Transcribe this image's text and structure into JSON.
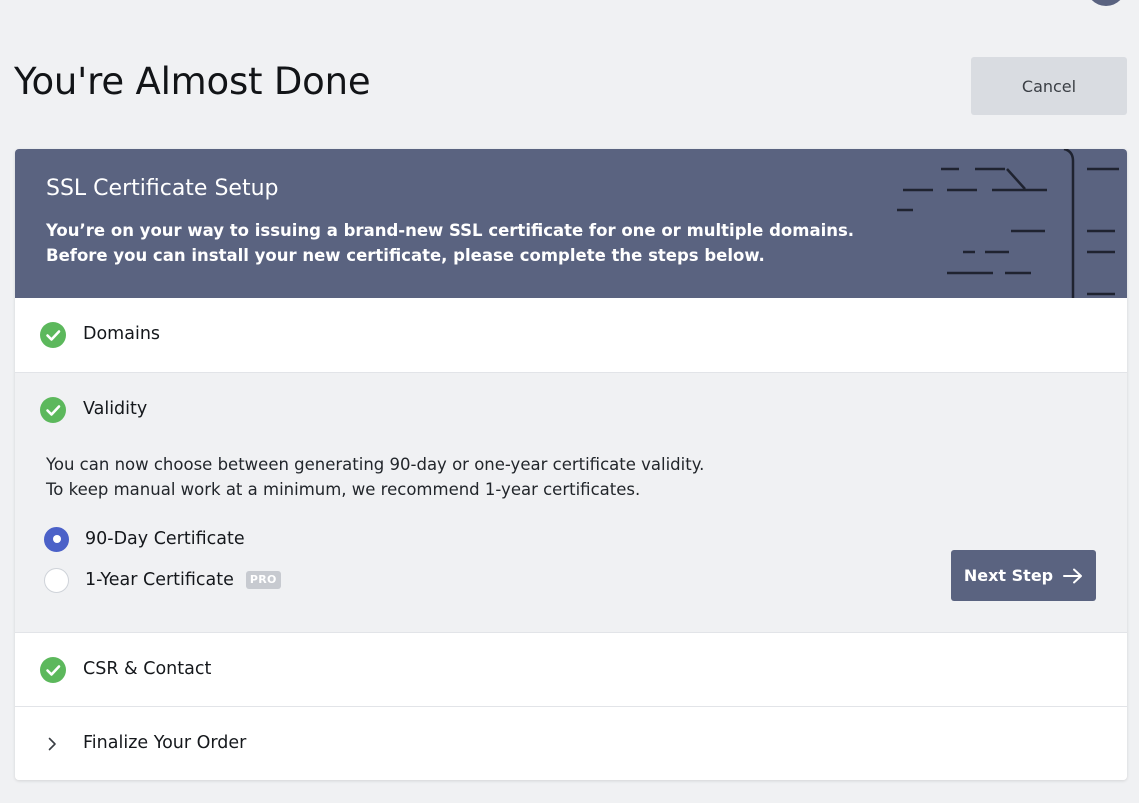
{
  "page": {
    "title": "You're Almost Done",
    "cancel_label": "Cancel"
  },
  "header": {
    "title": "SSL Certificate Setup",
    "description_line1": "You’re on your way to issuing a brand-new SSL certificate for one or multiple domains.",
    "description_line2": "Before you can install your new certificate, please complete the steps below."
  },
  "steps": [
    {
      "label": "Domains",
      "status": "complete",
      "icon": "check-circle-icon"
    },
    {
      "label": "Validity",
      "status": "complete",
      "icon": "check-circle-icon",
      "expanded": true
    },
    {
      "label": "CSR & Contact",
      "status": "complete",
      "icon": "check-circle-icon"
    },
    {
      "label": "Finalize Your Order",
      "status": "pending",
      "icon": "chevron-right-icon"
    }
  ],
  "validity": {
    "description_line1": "You can now choose between generating 90-day or one-year certificate validity.",
    "description_line2": "To keep manual work at a minimum, we recommend 1-year certificates.",
    "options": [
      {
        "label": "90-Day Certificate",
        "selected": true
      },
      {
        "label": "1-Year Certificate",
        "selected": false,
        "badge": "PRO"
      }
    ],
    "next_label": "Next Step"
  },
  "colors": {
    "header_bg": "#5a6380",
    "check_green": "#5cb85c",
    "radio_selected": "#4b61c8",
    "page_bg": "#f0f1f3"
  }
}
